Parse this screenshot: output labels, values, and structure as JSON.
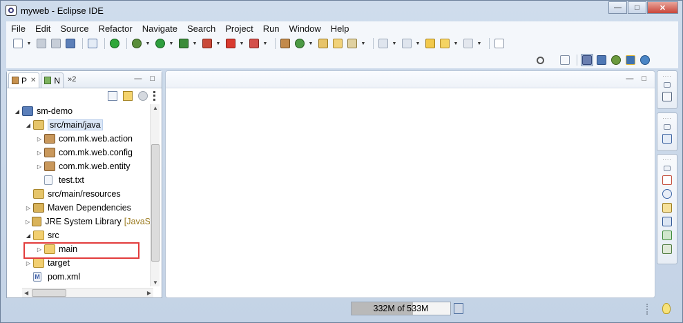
{
  "window": {
    "title": "myweb - Eclipse IDE",
    "controls": [
      "—",
      "□",
      "✕"
    ]
  },
  "menubar": [
    "File",
    "Edit",
    "Source",
    "Refactor",
    "Navigate",
    "Search",
    "Project",
    "Run",
    "Window",
    "Help"
  ],
  "toolbar": {
    "icons": [
      "new-icon",
      "save-icon",
      "save-all-icon",
      "terminal-icon",
      "skip-breakpoints-icon",
      "server-start-icon",
      "debug-icon",
      "run-icon",
      "coverage-icon",
      "profile-icon",
      "stop-icon",
      "external-tools-icon",
      "new-java-project-icon",
      "new-class-icon",
      "open-type-icon",
      "open-task-icon",
      "search-icon",
      "next-annotation-icon",
      "prev-annotation-icon",
      "last-edit-icon",
      "back-icon",
      "forward-icon",
      "pin-editor-icon"
    ],
    "perspectives": [
      "open-perspective-icon",
      "java-ee-perspective-icon",
      "svn-perspective-icon",
      "debug-perspective-icon",
      "python-perspective-icon",
      "team-perspective-icon"
    ]
  },
  "left_view": {
    "tabs": [
      {
        "label": "P",
        "close": "✕"
      },
      {
        "label": "N",
        "close": ""
      }
    ],
    "overflow_label": "»2",
    "tree": [
      {
        "label": "sm-demo",
        "twisty": "◢",
        "indent": 0,
        "icon": "project"
      },
      {
        "label": "src/main/java",
        "twisty": "◢",
        "indent": 1,
        "icon": "pkgroot",
        "highlight": true
      },
      {
        "label": "com.mk.web.action",
        "twisty": "▷",
        "indent": 2,
        "icon": "package"
      },
      {
        "label": "com.mk.web.config",
        "twisty": "▷",
        "indent": 2,
        "icon": "package"
      },
      {
        "label": "com.mk.web.entity",
        "twisty": "▷",
        "indent": 2,
        "icon": "package"
      },
      {
        "label": "test.txt",
        "twisty": "",
        "indent": 2,
        "icon": "file"
      },
      {
        "label": "src/main/resources",
        "twisty": "",
        "indent": 1,
        "icon": "pkgroot"
      },
      {
        "label": "Maven Dependencies",
        "twisty": "▷",
        "indent": 1,
        "icon": "lib"
      },
      {
        "label": "JRE System Library",
        "extra": "[JavaS",
        "twisty": "▷",
        "indent": 1,
        "icon": "lib"
      },
      {
        "label": "src",
        "twisty": "◢",
        "indent": 1,
        "icon": "folder"
      },
      {
        "label": "main",
        "twisty": "▷",
        "indent": 2,
        "icon": "folder"
      },
      {
        "label": "target",
        "twisty": "▷",
        "indent": 1,
        "icon": "folder"
      },
      {
        "label": "pom.xml",
        "twisty": "",
        "indent": 1,
        "icon": "pom"
      }
    ]
  },
  "statusbar": {
    "heap_label": "332M of 533M",
    "heap_used_fraction": 0.62
  }
}
